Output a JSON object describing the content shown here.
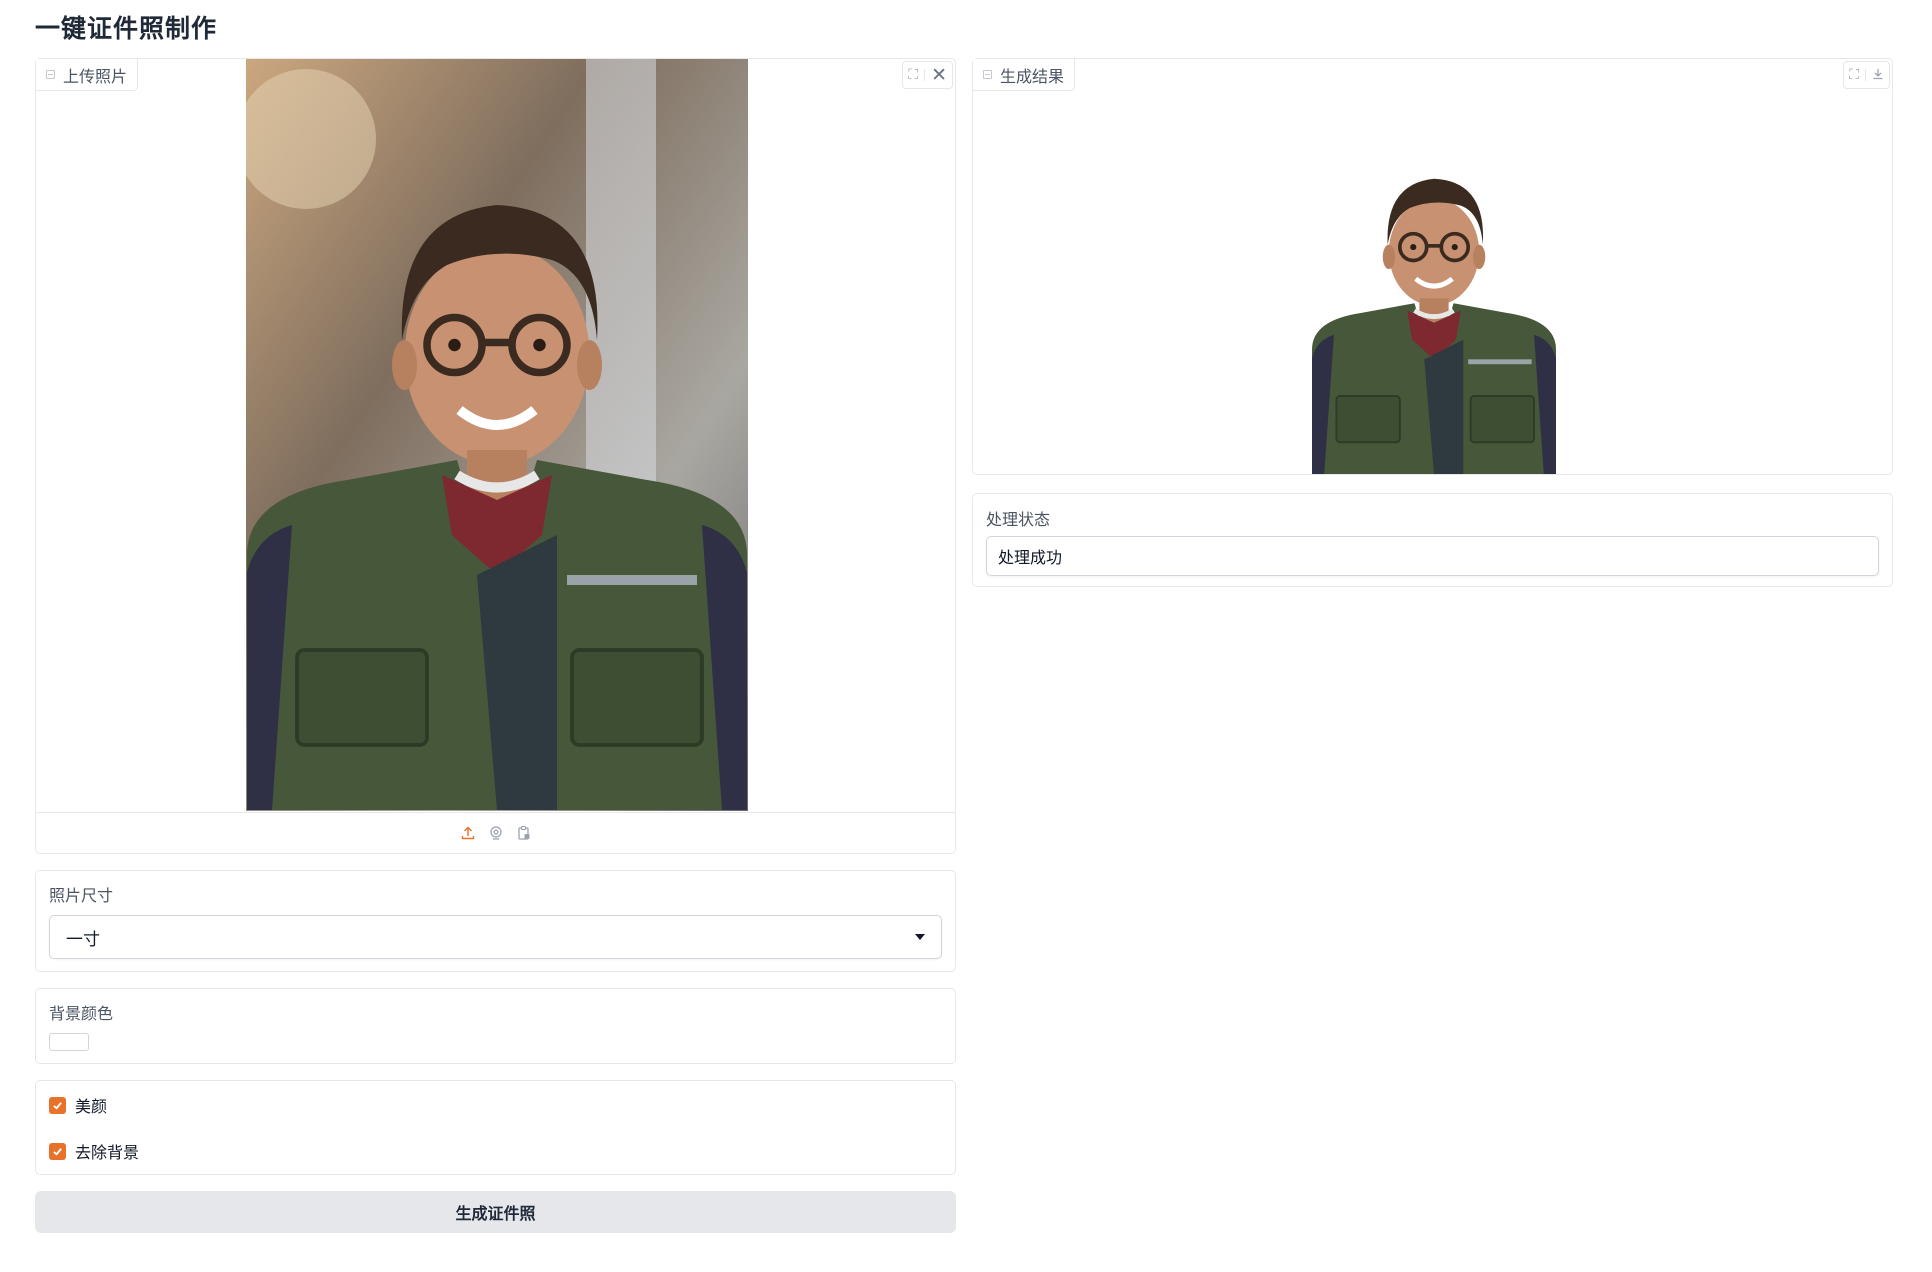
{
  "page": {
    "title": "一键证件照制作"
  },
  "upload": {
    "label": "上传照片",
    "icons": [
      "fullscreen-icon",
      "close-icon",
      "upload-icon",
      "webcam-icon",
      "clipboard-icon"
    ]
  },
  "size": {
    "label": "照片尺寸",
    "value": "一寸"
  },
  "background": {
    "label": "背景颜色",
    "color": "#ffffff"
  },
  "options": [
    {
      "label": "美颜",
      "checked": true
    },
    {
      "label": "去除背景",
      "checked": true
    }
  ],
  "generate": {
    "label": "生成证件照"
  },
  "result": {
    "label": "生成结果",
    "icons": [
      "fullscreen-icon",
      "download-icon"
    ]
  },
  "status": {
    "label": "处理状态",
    "value": "处理成功"
  },
  "colors": {
    "accent": "#e8722a",
    "border": "#e5e7eb",
    "button_bg": "#e5e7eb"
  }
}
